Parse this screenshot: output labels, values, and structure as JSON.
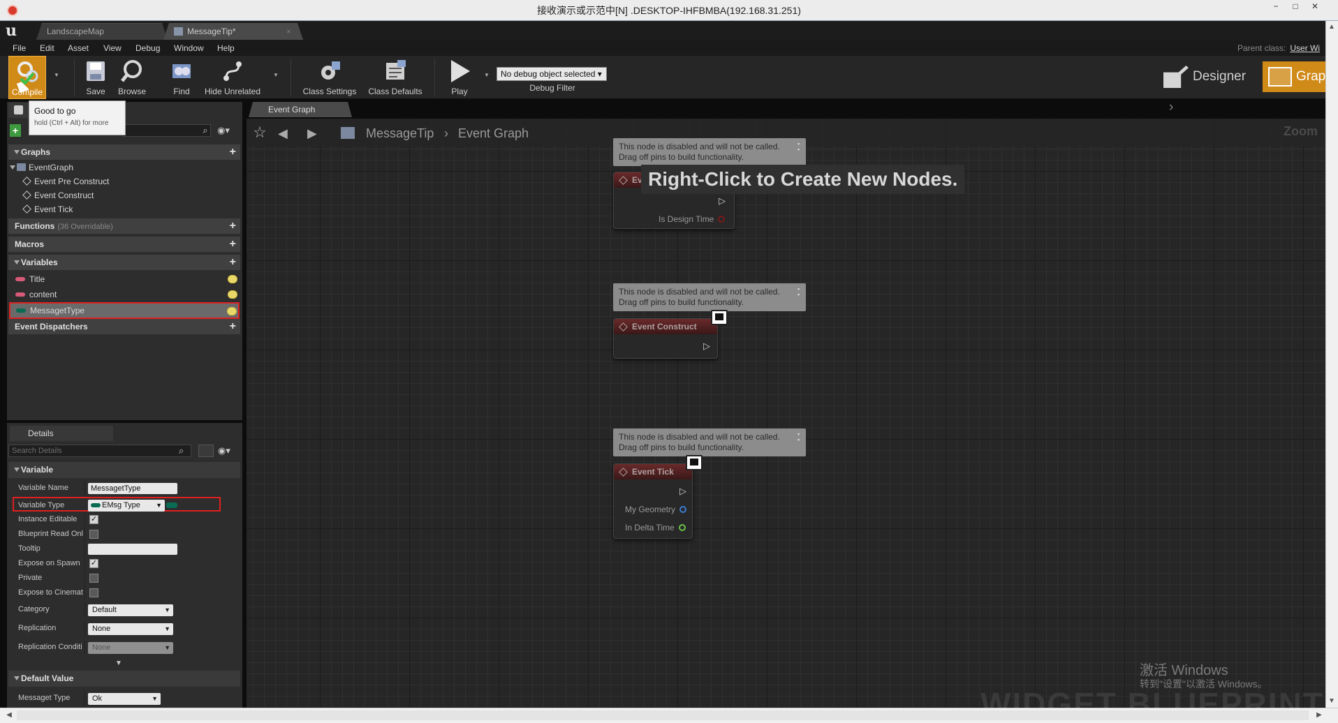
{
  "window": {
    "title": "接收演示或示范中[N] .DESKTOP-IHFBMBA(192.168.31.251)",
    "controls": [
      "−",
      "□",
      "✕"
    ]
  },
  "tabs": [
    {
      "label": "LandscapeMap"
    },
    {
      "label": "MessageTip*"
    }
  ],
  "menu": [
    "File",
    "Edit",
    "Asset",
    "View",
    "Debug",
    "Window",
    "Help"
  ],
  "parent_class": {
    "label": "Parent class:",
    "value": "User Wi"
  },
  "toolbar": {
    "compile": "Compile",
    "save": "Save",
    "browse": "Browse",
    "find": "Find",
    "hide_unrelated": "Hide Unrelated",
    "class_settings": "Class Settings",
    "class_defaults": "Class Defaults",
    "play": "Play",
    "debug_select": "No debug object selected",
    "debug_filter": "Debug Filter",
    "designer": "Designer",
    "graph": "Graph"
  },
  "tooltip": {
    "title": "Good to go",
    "subtitle": "hold (Ctrl + Alt) for more"
  },
  "my_blueprint": {
    "graphs_label": "Graphs",
    "event_graph": "EventGraph",
    "events": [
      "Event Pre Construct",
      "Event Construct",
      "Event Tick"
    ],
    "functions_label": "Functions",
    "functions_count": "(36 Overridable)",
    "macros_label": "Macros",
    "variables_label": "Variables",
    "variables": [
      {
        "name": "Title",
        "color": "#d85a78"
      },
      {
        "name": "content",
        "color": "#d85a78"
      },
      {
        "name": "MessagetType",
        "color": "#0a6b54"
      }
    ],
    "dispatchers_label": "Event Dispatchers"
  },
  "details": {
    "tab": "Details",
    "search_placeholder": "Search Details",
    "variable_section": "Variable",
    "props": {
      "variable_name": {
        "label": "Variable Name",
        "value": "MessagetType"
      },
      "variable_type": {
        "label": "Variable Type",
        "value": "EMsg Type"
      },
      "instance_editable": {
        "label": "Instance Editable",
        "checked": true
      },
      "bp_read_only": {
        "label": "Blueprint Read Onl",
        "checked": false
      },
      "tooltip": {
        "label": "Tooltip",
        "value": ""
      },
      "expose_on_spawn": {
        "label": "Expose on Spawn",
        "checked": true
      },
      "private": {
        "label": "Private",
        "checked": false
      },
      "expose_cinematics": {
        "label": "Expose to Cinemat",
        "checked": false
      },
      "category": {
        "label": "Category",
        "value": "Default"
      },
      "replication": {
        "label": "Replication",
        "value": "None"
      },
      "replication_condition": {
        "label": "Replication Conditi",
        "value": "None"
      }
    },
    "default_value_section": "Default Value",
    "default_value": {
      "label": "Messaget Type",
      "value": "Ok"
    }
  },
  "graph": {
    "tab": "Event Graph",
    "breadcrumb": [
      "MessageTip",
      "Event Graph"
    ],
    "zoom": "Zoom",
    "hint": "Right-Click to Create New Nodes.",
    "disabled_comment_line1": "This node is disabled and will not be called.",
    "disabled_comment_line2": "Drag off pins to build functionality.",
    "nodes": [
      {
        "title": "Ev",
        "pins": [
          "Is Design Time"
        ]
      },
      {
        "title": "Event Construct",
        "pins": []
      },
      {
        "title": "Event Tick",
        "pins": [
          "My Geometry",
          "In Delta Time"
        ]
      }
    ],
    "watermark": "WIDGET BLUEPRINT"
  },
  "os_watermark": {
    "line1": "激活 Windows",
    "line2": "转到\"设置\"以激活 Windows。"
  },
  "accent_color": "#d08a18",
  "highlight_color": "#e02020"
}
